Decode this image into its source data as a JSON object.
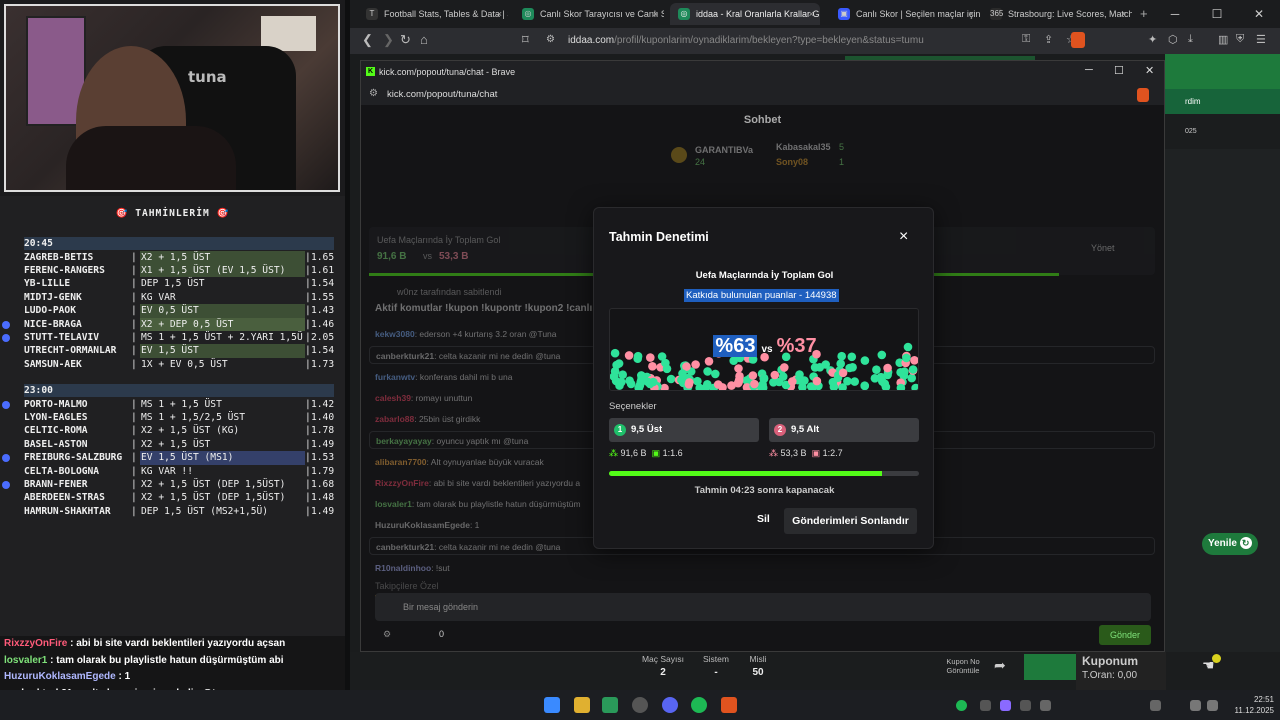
{
  "predictions": {
    "title": "🎯  TAHMİNLERİM  🎯",
    "groups": [
      {
        "time": "20:45",
        "rows": [
          {
            "match": "ZAGREB-BETIS",
            "pick": "X2 + 1,5 ÜST",
            "odd": "1.65",
            "dot": false,
            "hl": "hl"
          },
          {
            "match": "FERENC-RANGERS",
            "pick": "X1 + 1,5 ÜST (EV 1,5 ÜST)",
            "odd": "1.61",
            "dot": false,
            "hl": "hl"
          },
          {
            "match": "YB-LILLE",
            "pick": "DEP 1,5 ÜST",
            "odd": "1.54",
            "dot": false,
            "hl": ""
          },
          {
            "match": "MIDTJ-GENK",
            "pick": "KG VAR",
            "odd": "1.55",
            "dot": false,
            "hl": ""
          },
          {
            "match": "LUDO-PAOK",
            "pick": "EV 0,5 ÜST",
            "odd": "1.43",
            "dot": false,
            "hl": "hl"
          },
          {
            "match": "NICE-BRAGA",
            "pick": "X2 + DEP 0,5 ÜST",
            "odd": "1.46",
            "dot": true,
            "hl": "hl2"
          },
          {
            "match": "STUTT-TELAVIV",
            "pick": "MS 1 + 1,5 ÜST + 2.YARI 1,5Ü",
            "odd": "2.05",
            "dot": true,
            "hl": ""
          },
          {
            "match": "UTRECHT-ORMANLAR",
            "pick": "EV 1,5 ÜST",
            "odd": "1.54",
            "dot": false,
            "hl": "hl"
          },
          {
            "match": "SAMSUN-AEK",
            "pick": "1X + EV 0,5 ÜST",
            "odd": "1.73",
            "dot": false,
            "hl": ""
          }
        ]
      },
      {
        "time": "23:00",
        "rows": [
          {
            "match": "PORTO-MALMO",
            "pick": "MS 1 + 1,5 ÜST",
            "odd": "1.42",
            "dot": true,
            "hl": ""
          },
          {
            "match": "LYON-EAGLES",
            "pick": "MS 1 + 1,5/2,5 ÜST",
            "odd": "1.40",
            "dot": false,
            "hl": ""
          },
          {
            "match": "CELTIC-ROMA",
            "pick": "X2 + 1,5 ÜST (KG)",
            "odd": "1.78",
            "dot": false,
            "hl": ""
          },
          {
            "match": "BASEL-ASTON",
            "pick": "X2 + 1,5 ÜST",
            "odd": "1.49",
            "dot": false,
            "hl": ""
          },
          {
            "match": "FREIBURG-SALZBURG",
            "pick": "EV 1,5 ÜST (MS1)",
            "odd": "1.53",
            "dot": true,
            "hl": "hb"
          },
          {
            "match": "CELTA-BOLOGNA",
            "pick": "KG VAR !!",
            "odd": "1.79",
            "dot": false,
            "hl": ""
          },
          {
            "match": "BRANN-FENER",
            "pick": "X2 + 1,5 ÜST (DEP 1,5ÜST)",
            "odd": "1.68",
            "dot": true,
            "hl": ""
          },
          {
            "match": "ABERDEEN-STRAS",
            "pick": "X2 + 1,5 ÜST (DEP 1,5ÜST)",
            "odd": "1.48",
            "dot": false,
            "hl": ""
          },
          {
            "match": "HAMRUN-SHAKHTAR",
            "pick": "DEP 1,5 ÜST (MS2+1,5Ü)",
            "odd": "1.49",
            "dot": false,
            "hl": ""
          }
        ]
      }
    ]
  },
  "overlay_chat": [
    {
      "user": "RixzzyOnFire",
      "text": " : abi bi site vardı beklentileri yazıyordu açsan",
      "cls": "u"
    },
    {
      "user": "losvaler1",
      "text": " : tam olarak bu playlistle hatun düşürmüştüm abi",
      "cls": "u2"
    },
    {
      "user": "HuzuruKoklasamEgede",
      "text": " : 1",
      "cls": "u3"
    },
    {
      "user": "canberkturk21",
      "text": " : celta kazanir mi ne dedin @tuna",
      "cls": ""
    },
    {
      "user": "R10naldinhoo",
      "text": " : !sut",
      "cls": "u3"
    }
  ],
  "browser": {
    "tabs": [
      {
        "label": "Football Stats, Tables & Data | Soc",
        "icon": "T",
        "color": "#333"
      },
      {
        "label": "Canlı Skor Tarayıcısı ve Canlı Skorla",
        "icon": "◎",
        "color": "#1e8a5a"
      },
      {
        "label": "iddaa - Kral Oranlarla Krallar G",
        "icon": "◎",
        "color": "#1e8a5a"
      },
      {
        "label": "Canlı Skor | Seçilen maçlar için canl",
        "icon": "▣",
        "color": "#3a5aff"
      },
      {
        "label": "Strasbourg: Live Scores, Matches a",
        "icon": "365",
        "color": "#2a2a2a"
      }
    ],
    "new_tab": "+",
    "url_main": "iddaa.com",
    "url_path": "/profil/kuponlarim/oynadiklarim/bekleyen?type=bekleyen&status=tumu"
  },
  "popout": {
    "window_title": "kick.com/popout/tuna/chat - Brave",
    "url": "kick.com/popout/tuna/chat",
    "chat_title": "Sohbet",
    "leaderboard": [
      {
        "name": "GARANTIBVa",
        "value": "24"
      },
      {
        "name": "Kabasakal35",
        "value": "5"
      },
      {
        "name": "Sony08",
        "value": "1"
      }
    ],
    "poll_title": "Uefa Maçlarında İy Toplam Gol",
    "poll_green": "91,6 B",
    "poll_vs": "vs",
    "poll_red": "53,3 B",
    "manage": "Yönet",
    "pinned_by": "w0nz tarafından sabitlendi",
    "pinned": "Aktif komutlar !kupon !kupontr !kupon2 !canlı",
    "messages": [
      {
        "user": "kekw3080",
        "text": ": ederson +4 kurtarış 3.2 oran @Tuna",
        "color": "#7fb2ff",
        "box": false
      },
      {
        "user": "canberkturk21",
        "text": ": celta kazanir mi ne dedin @tuna",
        "color": "#ccc",
        "box": true
      },
      {
        "user": "furkanwtv",
        "text": ": konferans dahil mi b una",
        "color": "#7fb2ff",
        "box": false
      },
      {
        "user": "calesh39",
        "text": ": romayı unuttun",
        "color": "#ff4a6a",
        "box": false
      },
      {
        "user": "zabarlo88",
        "text": ": 25bin üst girdikk",
        "color": "#ff4a6a",
        "box": false
      },
      {
        "user": "berkayayayay",
        "text": ": oyuncu yaptık mı @tuna",
        "color": "#7fe27a",
        "box": true
      },
      {
        "user": "alibaran7700",
        "text": ": Alt oynuyanlae büyük vuracak",
        "color": "#ffb24a",
        "box": false
      },
      {
        "user": "RixzzyOnFire",
        "text": ": abi bi site vardı beklentileri yazıyordu a",
        "color": "#ff4a6a",
        "box": false
      },
      {
        "user": "losvaler1",
        "text": ": tam olarak bu playlistle hatun düşürmüştüm",
        "color": "#7fe27a",
        "box": false
      },
      {
        "user": "HuzuruKoklasamEgede",
        "text": ": 1",
        "color": "#ccc",
        "box": false
      },
      {
        "user": "canberkturk21",
        "text": ": celta kazanir mi ne dedin @tuna",
        "color": "#ccc",
        "box": true
      },
      {
        "user": "R10naldinhoo",
        "text": ": !sut",
        "color": "#b0b8ff",
        "box": false
      }
    ],
    "followers_label": "Takipçilere Özel",
    "input_placeholder": "Bir mesaj gönderin",
    "points": "0",
    "send": "Gönder"
  },
  "modal": {
    "title": "Tahmin Denetimi",
    "close": "×",
    "question": "Uefa Maçlarında İy Toplam Gol",
    "points_line": "Katkıda bulunulan puanlar - 144938",
    "pct_a": "%63",
    "vs": "vs",
    "pct_b": "%37",
    "options_label": "Seçenekler",
    "options": [
      {
        "num": "1",
        "label": "9,5 Üst",
        "points": "91,6 B",
        "ratio": "1:1.6",
        "color": "#1fbf6a"
      },
      {
        "num": "2",
        "label": "9,5 Alt",
        "points": "53,3 B",
        "ratio": "1:2.7",
        "color": "#d9607a"
      }
    ],
    "time_progress": 0.88,
    "closing_text": "Tahmin 04:23 sonra kapanacak",
    "delete": "Sil",
    "end": "Gönderimleri Sonlandır",
    "accent_green": "#2fe39a",
    "accent_pink": "#ff8fa3"
  },
  "page_bottom": {
    "mac_label": "Maç Sayısı",
    "mac_value": "2",
    "sistem_label": "Sistem",
    "sistem_value": "-",
    "misli_label": "Misli",
    "misli_value": "50",
    "kupon_no_label": "Kupon No Görüntüle",
    "kuponum": "Kuponum",
    "toran": "T.Oran: 0,00",
    "yenile": "Yenile",
    "right_text": "rdim",
    "right_year": "025"
  },
  "clock": {
    "time": "22:51",
    "date": "11.12.2025"
  }
}
